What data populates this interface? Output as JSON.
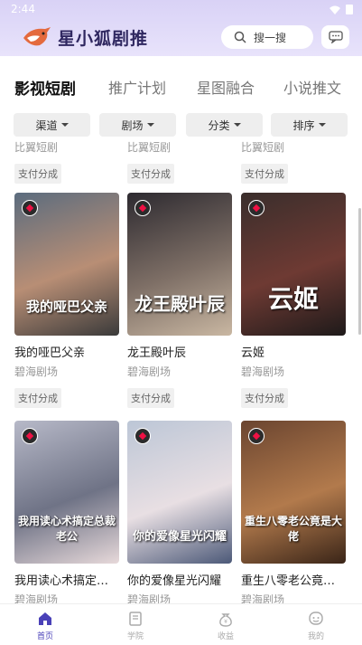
{
  "status": {
    "time": "2:44"
  },
  "header": {
    "title": "星小狐剧推",
    "search_placeholder": "搜一搜"
  },
  "tabs": [
    {
      "label": "影视短剧",
      "active": true
    },
    {
      "label": "推广计划",
      "active": false
    },
    {
      "label": "星图融合",
      "active": false
    },
    {
      "label": "小说推文",
      "active": false
    }
  ],
  "filters": [
    {
      "label": "渠道"
    },
    {
      "label": "剧场"
    },
    {
      "label": "分类"
    },
    {
      "label": "排序"
    }
  ],
  "top_row": [
    {
      "theatre": "比翼短剧",
      "tag": "支付分成"
    },
    {
      "theatre": "比翼短剧",
      "tag": "支付分成"
    },
    {
      "theatre": "比翼短剧",
      "tag": "支付分成"
    }
  ],
  "row1": [
    {
      "title": "我的哑巴父亲",
      "poster_text": "我的哑巴父亲",
      "theatre": "碧海剧场",
      "tag": "支付分成",
      "colors": [
        "#5b6c7e",
        "#b88e75",
        "#3a3a3a"
      ]
    },
    {
      "title": "龙王殿叶辰",
      "poster_text": "龙王殿叶辰",
      "theatre": "碧海剧场",
      "tag": "支付分成",
      "colors": [
        "#2d2a30",
        "#7e6f66",
        "#c9b7a2"
      ]
    },
    {
      "title": "云姬",
      "poster_text": "云姬",
      "theatre": "碧海剧场",
      "tag": "支付分成",
      "colors": [
        "#3a2e2c",
        "#6e3a33",
        "#1e1a1a"
      ]
    }
  ],
  "row2": [
    {
      "title": "我用读心术搞定总裁老公",
      "poster_text": "我用读心术搞定总裁老公",
      "theatre": "碧海剧场",
      "colors": [
        "#b7b9c8",
        "#6f7386",
        "#e7d9da"
      ]
    },
    {
      "title": "你的爱像星光闪耀",
      "poster_text": "你的爱像星光闪耀",
      "theatre": "碧海剧场",
      "colors": [
        "#bcc6d6",
        "#e8dfe3",
        "#4c5978"
      ]
    },
    {
      "title": "重生八零老公竟是大佬",
      "poster_text": "重生八零老公竟是大佬",
      "theatre": "碧海剧场",
      "colors": [
        "#6b4530",
        "#b27a4c",
        "#3a2518"
      ]
    }
  ],
  "bottom_nav": [
    {
      "label": "首页",
      "icon": "home-icon",
      "active": true
    },
    {
      "label": "学院",
      "icon": "book-icon",
      "active": false
    },
    {
      "label": "收益",
      "icon": "money-bag-icon",
      "active": false
    },
    {
      "label": "我的",
      "icon": "profile-icon",
      "active": false
    }
  ],
  "accent": "#4a41b8"
}
